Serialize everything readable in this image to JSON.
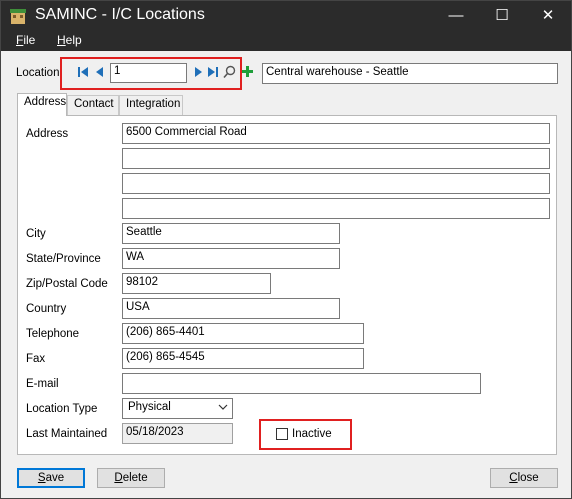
{
  "window": {
    "title": "SAMINC - I/C Locations",
    "minimize_glyph": "—",
    "maximize_glyph": "☐",
    "close_glyph": "✕"
  },
  "menu": {
    "file": {
      "underlined": "F",
      "rest": "ile"
    },
    "help": {
      "underlined": "H",
      "rest": "elp"
    }
  },
  "location": {
    "label": "Location",
    "code": "1",
    "description": "Central warehouse - Seattle"
  },
  "tabs": [
    {
      "label": "Address",
      "active": true
    },
    {
      "label": "Contact",
      "active": false
    },
    {
      "label": "Integration",
      "active": false
    }
  ],
  "address": {
    "label": "Address",
    "lines": [
      "6500 Commercial Road",
      "",
      "",
      ""
    ]
  },
  "city": {
    "label": "City",
    "value": "Seattle"
  },
  "state": {
    "label": "State/Province",
    "value": "WA"
  },
  "zip": {
    "label": "Zip/Postal Code",
    "value": "98102"
  },
  "country": {
    "label": "Country",
    "value": "USA"
  },
  "telephone": {
    "label": "Telephone",
    "value": "(206) 865-4401"
  },
  "fax": {
    "label": "Fax",
    "value": "(206) 865-4545"
  },
  "email": {
    "label": "E-mail",
    "value": ""
  },
  "location_type": {
    "label": "Location Type",
    "value": "Physical"
  },
  "last_maintained": {
    "label": "Last Maintained",
    "value": "05/18/2023"
  },
  "inactive": {
    "label": "Inactive",
    "checked": false
  },
  "buttons": {
    "save": {
      "underlined": "S",
      "rest": "ave"
    },
    "delete": {
      "underlined": "D",
      "rest": "elete"
    },
    "close": {
      "underlined": "C",
      "rest": "lose"
    }
  },
  "colors": {
    "titlebar": "#2b2b2b",
    "nav_arrow": "#1f6fb8",
    "add_icon": "#1e9e3a",
    "highlight_box": "#e02020"
  },
  "icons": [
    "app-icon",
    "first-record-icon",
    "previous-record-icon",
    "next-record-icon",
    "last-record-icon",
    "finder-icon",
    "add-icon",
    "dropdown-arrow-icon"
  ]
}
